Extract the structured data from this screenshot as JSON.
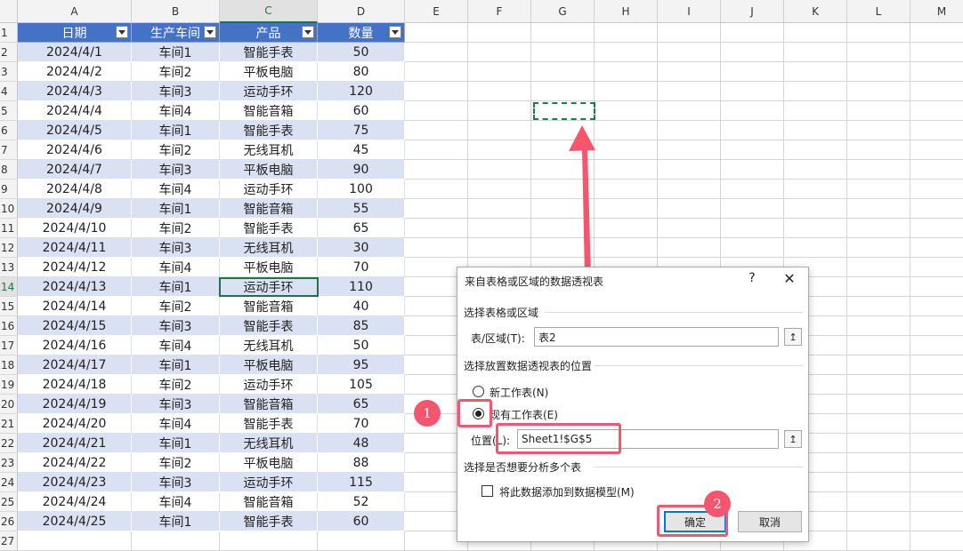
{
  "columns": [
    "A",
    "B",
    "C",
    "D",
    "E",
    "F",
    "G",
    "H",
    "I",
    "J",
    "K",
    "L",
    "M"
  ],
  "table": {
    "headers": [
      "日期",
      "生产车间",
      "产品",
      "数量"
    ],
    "rows": [
      [
        "2024/4/1",
        "车间1",
        "智能手表",
        "50"
      ],
      [
        "2024/4/2",
        "车间2",
        "平板电脑",
        "80"
      ],
      [
        "2024/4/3",
        "车间3",
        "运动手环",
        "120"
      ],
      [
        "2024/4/4",
        "车间4",
        "智能音箱",
        "60"
      ],
      [
        "2024/4/5",
        "车间1",
        "智能手表",
        "75"
      ],
      [
        "2024/4/6",
        "车间2",
        "无线耳机",
        "45"
      ],
      [
        "2024/4/7",
        "车间3",
        "平板电脑",
        "90"
      ],
      [
        "2024/4/8",
        "车间4",
        "运动手环",
        "100"
      ],
      [
        "2024/4/9",
        "车间1",
        "智能音箱",
        "55"
      ],
      [
        "2024/4/10",
        "车间2",
        "智能手表",
        "65"
      ],
      [
        "2024/4/11",
        "车间3",
        "无线耳机",
        "30"
      ],
      [
        "2024/4/12",
        "车间4",
        "平板电脑",
        "70"
      ],
      [
        "2024/4/13",
        "车间1",
        "运动手环",
        "110"
      ],
      [
        "2024/4/14",
        "车间2",
        "智能音箱",
        "40"
      ],
      [
        "2024/4/15",
        "车间3",
        "智能手表",
        "85"
      ],
      [
        "2024/4/16",
        "车间4",
        "无线耳机",
        "50"
      ],
      [
        "2024/4/17",
        "车间1",
        "平板电脑",
        "95"
      ],
      [
        "2024/4/18",
        "车间2",
        "运动手环",
        "105"
      ],
      [
        "2024/4/19",
        "车间3",
        "智能音箱",
        "65"
      ],
      [
        "2024/4/20",
        "车间4",
        "智能手表",
        "70"
      ],
      [
        "2024/4/21",
        "车间1",
        "无线耳机",
        "48"
      ],
      [
        "2024/4/22",
        "车间2",
        "平板电脑",
        "88"
      ],
      [
        "2024/4/23",
        "车间3",
        "运动手环",
        "115"
      ],
      [
        "2024/4/24",
        "车间4",
        "智能音箱",
        "52"
      ],
      [
        "2024/4/25",
        "车间1",
        "智能手表",
        "60"
      ]
    ]
  },
  "selected_cell": "C14",
  "dialog": {
    "title": "来自表格或区域的数据透视表",
    "help": "?",
    "close": "✕",
    "section_source": "选择表格或区域",
    "range_label": "表/区域(T):",
    "range_value": "表2",
    "section_location": "选择放置数据透视表的位置",
    "option_new": "新工作表(N)",
    "option_existing": "现有工作表(E)",
    "selected_option": "existing",
    "location_label": "位置(L):",
    "location_value": "Sheet1!$G$5",
    "section_multi": "选择是否想要分析多个表",
    "checkbox_label": "将此数据添加到数据模型(M)",
    "checkbox_checked": false,
    "ok": "确定",
    "cancel": "取消",
    "picker_icon": "↥"
  },
  "annotations": {
    "badge1": "1",
    "badge2": "2",
    "color": "#f4566e"
  }
}
